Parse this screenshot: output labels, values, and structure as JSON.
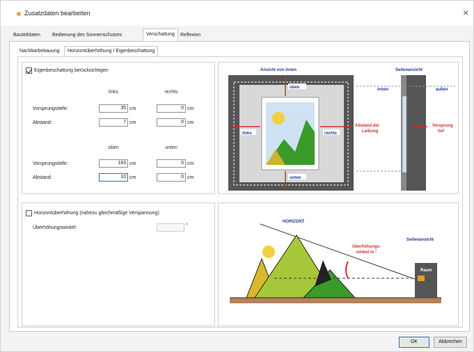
{
  "window": {
    "title": "Zusatzdaten bearbeiten",
    "close_label": "×"
  },
  "main_tabs": [
    "Bauteildaten",
    "Bedienung des Sonnenschutzes",
    "Verschattung",
    "Reflexion"
  ],
  "sub_tabs": [
    "Nachbarbebauung",
    "Horizontüberhöhung / Eigenbeschattung"
  ],
  "self_shading": {
    "checkbox_label": "Eigenbeschattung berücksichtigen",
    "checked": true,
    "head_left": "links",
    "head_right": "rechts",
    "head_top": "oben",
    "head_bottom": "unten",
    "rows_lr": [
      {
        "label": "Vorsprungstiefe:",
        "left": "35",
        "right": "0"
      },
      {
        "label": "Abstand:",
        "left": "7",
        "right": "0"
      }
    ],
    "rows_tb": [
      {
        "label": "Vorsprungstiefe:",
        "top": "183",
        "bottom": "0"
      },
      {
        "label": "Abstand:",
        "top": "10",
        "bottom": "0"
      }
    ],
    "unit": "cm"
  },
  "horizon": {
    "checkbox_label": "Horizontüberhöhung (nahezu gleichmäßige Verspannung)",
    "checked": false,
    "angle_label": "Überhöhungswinkel:",
    "angle_value": "",
    "angle_unit": "°"
  },
  "diagram_window": {
    "title_inside": "Ansicht von innen",
    "title_side": "Seitenansicht",
    "top": "oben",
    "bottom": "unten",
    "left": "links",
    "right": "rechts",
    "distance": "Abstand der Laibung",
    "inner": "innen",
    "outer": "außen",
    "projection": "Vorsprung tief"
  },
  "diagram_horizon": {
    "horizon": "HORIZONT",
    "side_view": "Seitenansicht",
    "angle": "Überhöhungs- winkel in °",
    "room": "Raum"
  },
  "buttons": {
    "ok": "OK",
    "cancel": "Abbrechen"
  },
  "colors": {
    "accent": "#2c6bd6",
    "red": "#d0312d",
    "navy": "#1f3a93",
    "green": "#3a9b2a",
    "yellow": "#e7c237",
    "earth": "#b5835a"
  }
}
